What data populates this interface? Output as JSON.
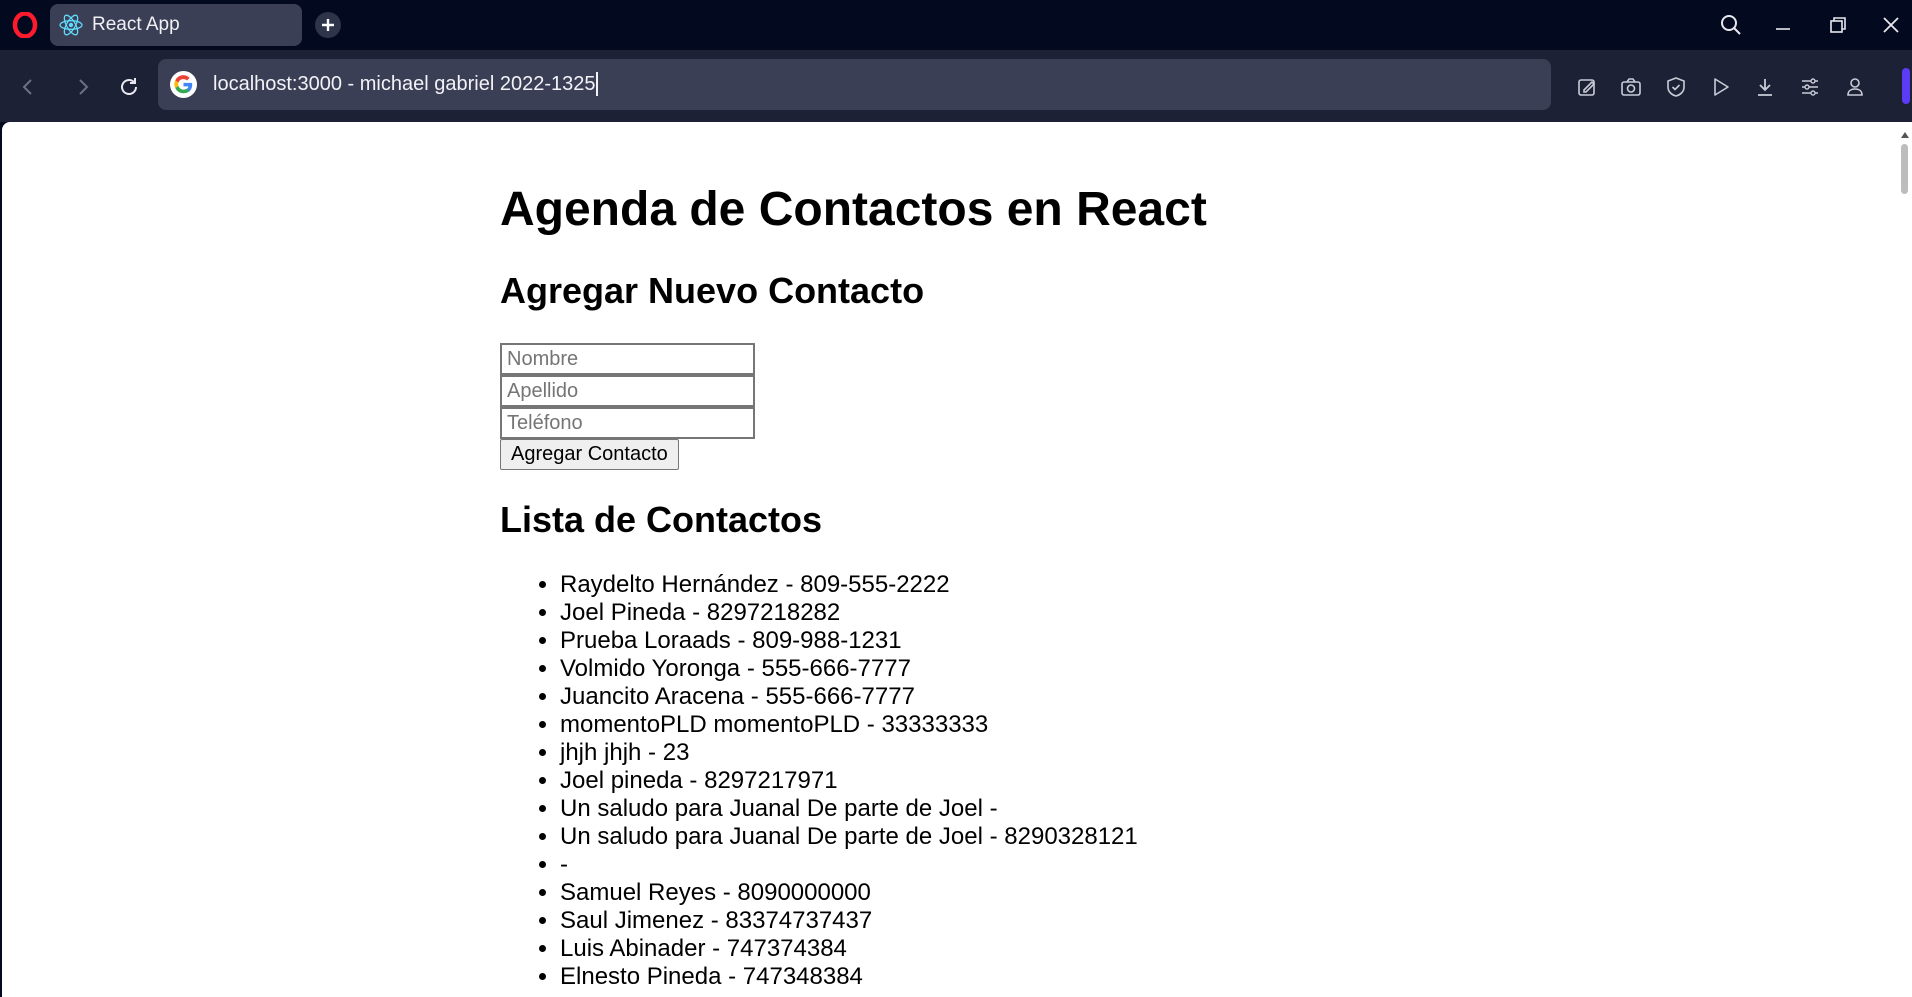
{
  "browser": {
    "tab_title": "React App",
    "url": "localhost:3000 - michael gabriel 2022-1325",
    "icons": [
      "opera-logo",
      "react-icon",
      "new-tab-plus",
      "search",
      "minimize",
      "restore",
      "close",
      "back",
      "forward",
      "reload",
      "google",
      "snapshot-edit",
      "camera",
      "shield",
      "play",
      "download",
      "easy-setup",
      "profile"
    ]
  },
  "page": {
    "title": "Agenda de Contactos en React",
    "add_heading": "Agregar Nuevo Contacto",
    "form": {
      "nombre_placeholder": "Nombre",
      "apellido_placeholder": "Apellido",
      "telefono_placeholder": "Teléfono",
      "submit_label": "Agregar Contacto"
    },
    "list_heading": "Lista de Contactos",
    "contacts": [
      "Raydelto Hernández - 809-555-2222",
      "Joel Pineda - 8297218282",
      "Prueba Loraads - 809-988-1231",
      "Volmido Yoronga - 555-666-7777",
      "Juancito Aracena - 555-666-7777",
      "momentoPLD momentoPLD - 33333333",
      "jhjh jhjh - 23",
      "Joel pineda - 8297217971",
      "Un saludo para Juanal De parte de Joel -",
      "Un saludo para Juanal De parte de Joel - 8290328121",
      " -",
      "Samuel Reyes - 8090000000",
      "Saul Jimenez - 83374737437",
      "Luis Abinader - 747374384",
      "Elnesto Pineda - 747348384"
    ]
  },
  "colors": {
    "chrome_bg": "#03091f",
    "toolbar_bg": "#1c2135",
    "urlbar_bg": "#3a3f56",
    "accent": "#5b3cf5",
    "opera_red": "#ff1b2d"
  }
}
